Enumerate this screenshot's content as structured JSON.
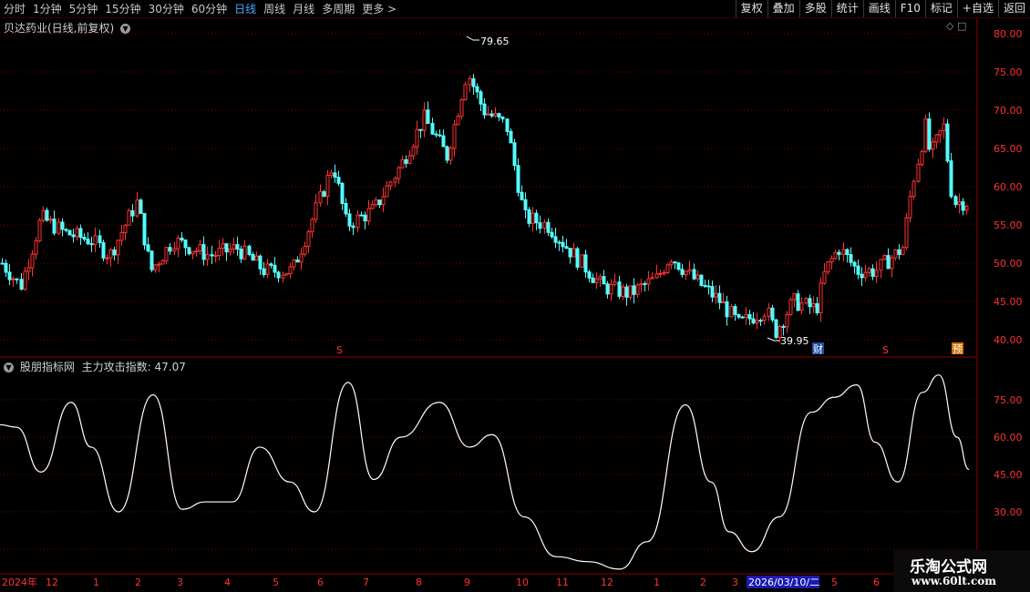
{
  "toolbar": {
    "periods": [
      "分时",
      "1分钟",
      "5分钟",
      "15分钟",
      "30分钟",
      "60分钟",
      "日线",
      "周线",
      "月线",
      "多周期",
      "更多 >"
    ],
    "active_period": "日线",
    "buttons": [
      "复权",
      "叠加",
      "多股",
      "统计",
      "画线",
      "F10",
      "标记",
      "+自选",
      "返回"
    ]
  },
  "main_chart": {
    "title": "贝达药业(日线,前复权)",
    "y_ticks": [
      "80.00",
      "75.00",
      "70.00",
      "65.00",
      "60.00",
      "55.00",
      "50.00",
      "45.00",
      "40.00"
    ],
    "high_label": "79.65",
    "low_label": "39.95",
    "markers": [
      "S",
      "财",
      "S",
      "预"
    ]
  },
  "indicator": {
    "title": "股朋指标网",
    "name_value": "主力攻击指数: 47.07",
    "y_ticks": [
      "75.00",
      "60.00",
      "45.00",
      "30.00"
    ]
  },
  "timeline": {
    "labels": [
      "2024年",
      "12",
      "1",
      "2",
      "3",
      "4",
      "5",
      "6",
      "7",
      "8",
      "9",
      "10",
      "11",
      "12",
      "1",
      "2",
      "3",
      "5",
      "6"
    ],
    "cursor_label": "2026/03/10/二"
  },
  "watermark": {
    "line1": "乐淘公式网",
    "line2": "www.60lt.com"
  },
  "colors": {
    "up": "#ff3232",
    "down": "#54fcfc",
    "grid": "#8b0000",
    "indicator_line": "#ffffff",
    "active_tab": "#4aa6ff"
  }
}
